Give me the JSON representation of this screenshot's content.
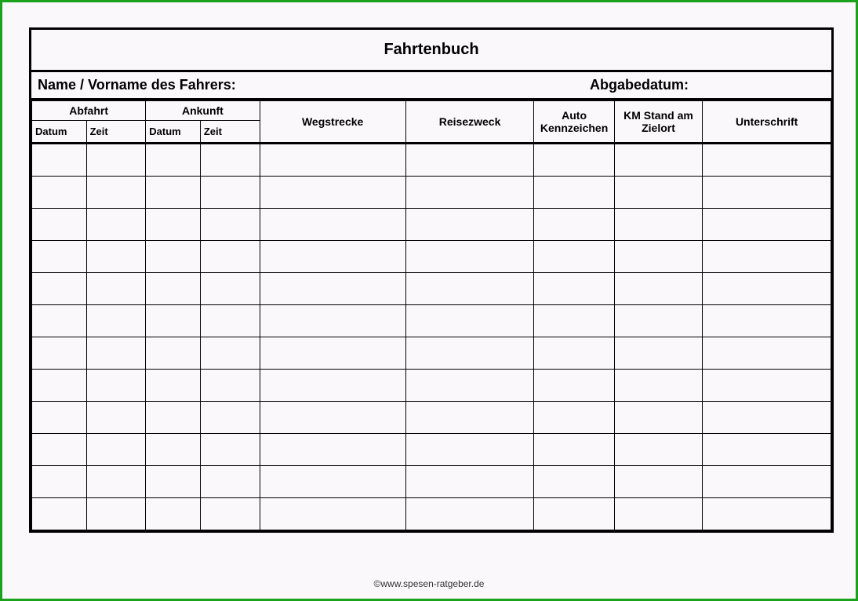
{
  "title": "Fahrtenbuch",
  "meta": {
    "name_label": "Name / Vorname des Fahrers:",
    "date_label": "Abgabedatum:"
  },
  "headers": {
    "abfahrt": "Abfahrt",
    "ankunft": "Ankunft",
    "datum": "Datum",
    "zeit": "Zeit",
    "wegstrecke": "Wegstrecke",
    "reisezweck": "Reisezweck",
    "kennzeichen": "Auto Kennzeichen",
    "kmstand": "KM Stand am Zielort",
    "unterschrift": "Unterschrift"
  },
  "rows": 12,
  "footer": "©www.spesen-ratgeber.de"
}
